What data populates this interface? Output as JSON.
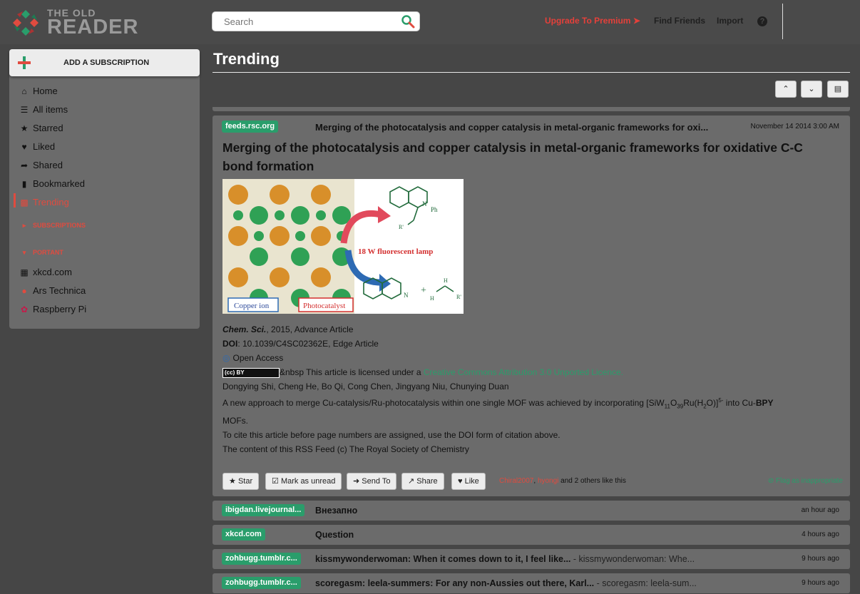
{
  "header": {
    "logo_line1": "THE OLD",
    "logo_line2": "READER",
    "search_placeholder": "Search",
    "premium_label": "Upgrade To Premium",
    "friends_label": "Find Friends",
    "import_label": "Import",
    "help_label": "?"
  },
  "sidebar": {
    "add_subscription": "ADD A SUBSCRIPTION",
    "nav": [
      {
        "label": "Home",
        "icon": "home-icon"
      },
      {
        "label": "All items",
        "icon": "list-icon"
      },
      {
        "label": "Starred",
        "icon": "star-icon"
      },
      {
        "label": "Liked",
        "icon": "heart-icon"
      },
      {
        "label": "Shared",
        "icon": "share-icon"
      },
      {
        "label": "Bookmarked",
        "icon": "bookmark-icon"
      },
      {
        "label": "Trending",
        "icon": "bar-chart-icon"
      }
    ],
    "subscriptions_label": "SUBSCRIPTIONS",
    "portant_label": "PORTANT",
    "feeds": [
      {
        "label": "xkcd.com"
      },
      {
        "label": "Ars Technica"
      },
      {
        "label": "Raspberry Pi"
      }
    ]
  },
  "main": {
    "title": "Trending",
    "article": {
      "source": "feeds.rsc.org",
      "header_title": "Merging of the photocatalysis and copper catalysis in metal-organic frameworks for oxi...",
      "date": "November 14 2014 3:00 AM",
      "title": "Merging of the photocatalysis and copper catalysis in metal-organic frameworks for oxidative C-C bond formation",
      "image": {
        "lamp_label": "18 W fluorescent lamp",
        "copper_label": "Copper  ion",
        "photocatalyst_label": "Photocatalyst",
        "ph_label": "Ph",
        "n_label": "N",
        "r_label": "R'",
        "h_label": "H",
        "plus": "+"
      },
      "journal": "Chem. Sci.",
      "journal_rest": ", 2015, Advance Article",
      "doi_label": "DOI",
      "doi_rest": ": 10.1039/C4SC02362E, Edge Article",
      "open_access": "Open Access",
      "cc_badge": "(cc) BY",
      "license_prefix": "&nbsp This article is licensed under a ",
      "license_link": "Creative Commons Attribution 3.0 Unported Licence.",
      "authors": "Dongying Shi, Cheng He, Bo Qi, Cong Chen, Jingyang Niu, Chunying Duan",
      "abstract_a": "A new approach to merge Cu-catalysis/Ru-photocatalysis within one single MOF was achieved by incorporating [SiW",
      "abstract_sub1": "11",
      "abstract_b": "O",
      "abstract_sub2": "39",
      "abstract_c": "Ru(H",
      "abstract_sub3": "2",
      "abstract_d": "O)]",
      "abstract_sup": "5-",
      "abstract_e": " into Cu-",
      "abstract_bold": "BPY",
      "abstract_f": "MOFs.",
      "cite_note": "To cite this article before page numbers are assigned, use the DOI form of citation above.",
      "rss_note": "The content of this RSS Feed (c) The Royal Society of Chemistry",
      "actions": {
        "star": "Star",
        "mark_unread": "Mark as unread",
        "send_to": "Send To",
        "share": "Share",
        "like": "Like"
      },
      "likers": {
        "user1": "Chiral2007",
        "sep": ", ",
        "user2": "hyongi",
        "rest": " and 2 others like this"
      },
      "flag": "Flag as inappropriate"
    },
    "rows": [
      {
        "source": "ibigdan.livejournal...",
        "title": "Внезапно",
        "snippet": "",
        "date": "an hour ago"
      },
      {
        "source": "xkcd.com",
        "title": "Question",
        "snippet": "",
        "date": "4 hours ago"
      },
      {
        "source": "zohbugg.tumblr.c...",
        "title": "kissmywonderwoman: When it comes down to it, I feel like...",
        "snippet": " - kissmywonderwoman: Whe...",
        "date": "9 hours ago"
      },
      {
        "source": "zohbugg.tumblr.c...",
        "title": "scoregasm: leela-summers: For any non-Aussies out there, Karl...",
        "snippet": " - scoregasm: leela-sum...",
        "date": "9 hours ago"
      }
    ]
  },
  "colors": {
    "accent_red": "#e04b3f",
    "accent_green": "#2a9d6b",
    "panel": "#6b6b6b",
    "background": "#464646"
  }
}
